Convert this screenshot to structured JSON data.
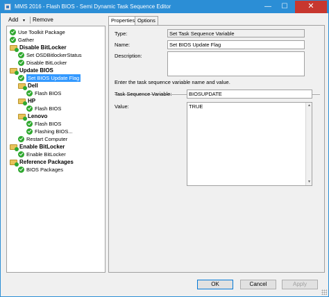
{
  "window": {
    "title": "MMS 2016 - Flash BIOS - Semi Dynamic Task Sequence Editor"
  },
  "titlebar": {
    "minimize": "—",
    "maximize": "☐",
    "close": "✕"
  },
  "toolbar": {
    "add_label": "Add",
    "add_caret": "▾",
    "remove_label": "Remove"
  },
  "tree": {
    "items": [
      {
        "label": "Use Toolkit Package",
        "icon": "check-icon"
      },
      {
        "label": "Gather",
        "icon": "check-icon"
      },
      {
        "label": "Disable BitLocker",
        "icon": "folder-icon"
      },
      {
        "label": "Set OSDBitlockerStatus",
        "icon": "check-icon"
      },
      {
        "label": "Disable BitLocker",
        "icon": "check-icon"
      },
      {
        "label": "Update BIOS",
        "icon": "folder-icon"
      },
      {
        "label": "Set BIOS Update Flag",
        "icon": "check-icon"
      },
      {
        "label": "Dell",
        "icon": "folder-icon"
      },
      {
        "label": "Flash BIOS",
        "icon": "check-icon"
      },
      {
        "label": "HP",
        "icon": "folder-icon"
      },
      {
        "label": "Flash BIOS",
        "icon": "check-icon"
      },
      {
        "label": "Lenovo",
        "icon": "folder-icon"
      },
      {
        "label": "Flash BIOS",
        "icon": "check-icon"
      },
      {
        "label": "Flashing BIOS...",
        "icon": "check-icon"
      },
      {
        "label": "Restart Computer",
        "icon": "check-icon"
      },
      {
        "label": "Enable BitLocker",
        "icon": "folder-icon"
      },
      {
        "label": "Enable BitLocker",
        "icon": "check-icon"
      },
      {
        "label": "Reference Packages",
        "icon": "folder-icon"
      },
      {
        "label": "BIOS Packages",
        "icon": "check-icon"
      }
    ]
  },
  "tabs": [
    {
      "label": "Properties"
    },
    {
      "label": "Options"
    }
  ],
  "properties": {
    "type_label": "Type:",
    "type_value": "Set Task Sequence Variable",
    "name_label": "Name:",
    "name_value": "Set BIOS Update Flag",
    "description_label": "Description:",
    "description_value": "",
    "instruction": "Enter the task sequence variable name and value.",
    "variable_label": "Task Sequence Variable:",
    "variable_value": "BIOSUPDATE",
    "value_label": "Value:",
    "value_value": "TRUE"
  },
  "buttons": {
    "ok": "OK",
    "cancel": "Cancel",
    "apply": "Apply"
  },
  "colors": {
    "titlebar": "#2b8ed6",
    "selection": "#3399ff",
    "close": "#c7372f",
    "status_ok": "#2fa82f",
    "folder": "#e8c35a"
  }
}
